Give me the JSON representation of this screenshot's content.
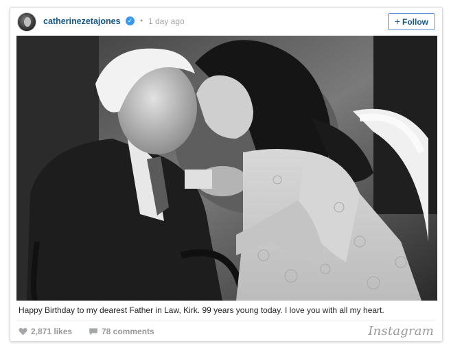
{
  "post": {
    "username": "catherinezetajones",
    "verified_mark": "✓",
    "separator": "•",
    "time_ago": "1 day ago",
    "follow_label": "Follow",
    "follow_plus": "+",
    "caption": "Happy Birthday to my dearest Father in Law, Kirk. 99 years young today. I love you with all my heart.",
    "likes": "2,871 likes",
    "comments": "78 comments",
    "brand": "Instagram"
  },
  "icons": {
    "verified": "verified-badge-icon",
    "heart": "heart-icon",
    "comment": "comment-bubble-icon"
  },
  "colors": {
    "username": "#125688",
    "verified": "#3897f0",
    "muted": "#a5a7aa",
    "follow_border": "#4e8fd6"
  }
}
